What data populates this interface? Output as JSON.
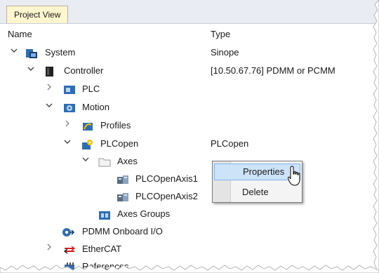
{
  "tab": {
    "label": "Project View"
  },
  "columns": {
    "name": "Name",
    "type": "Type"
  },
  "tree": {
    "system": {
      "label": "System",
      "type": "Sinope"
    },
    "controller": {
      "label": "Controller",
      "type": "[10.50.67.76] PDMM or PCMM"
    },
    "plc": {
      "label": "PLC"
    },
    "motion": {
      "label": "Motion"
    },
    "profiles": {
      "label": "Profiles"
    },
    "plcopen": {
      "label": "PLCopen",
      "type": "PLCopen"
    },
    "axes": {
      "label": "Axes"
    },
    "axis1": {
      "label": "PLCOpenAxis1"
    },
    "axis2": {
      "label": "PLCOpenAxis2"
    },
    "axes_groups": {
      "label": "Axes Groups"
    },
    "pdmm_io": {
      "label": "PDMM Onboard I/O"
    },
    "ethercat": {
      "label": "EtherCAT"
    },
    "references": {
      "label": "References"
    }
  },
  "context_menu": {
    "properties": "Properties",
    "delete": "Delete"
  },
  "icons": {
    "expanded": "chevron-down-icon",
    "collapsed": "chevron-right-icon",
    "system": "system-icon",
    "controller": "controller-icon",
    "plc": "plc-icon",
    "motion": "motion-icon",
    "profiles": "profiles-icon",
    "plcopen": "plcopen-icon",
    "folder": "folder-icon",
    "axis": "axis-icon",
    "axes_group": "axes-group-icon",
    "io": "io-icon",
    "ethercat": "ethercat-icon",
    "references": "references-icon"
  },
  "colors": {
    "tab_background": "#fff6cf",
    "menu_highlight": "#cce3f8",
    "menu_highlight_border": "#7eb4ea",
    "ethercat_red": "#d32020",
    "icon_blue": "#2f6db5"
  }
}
